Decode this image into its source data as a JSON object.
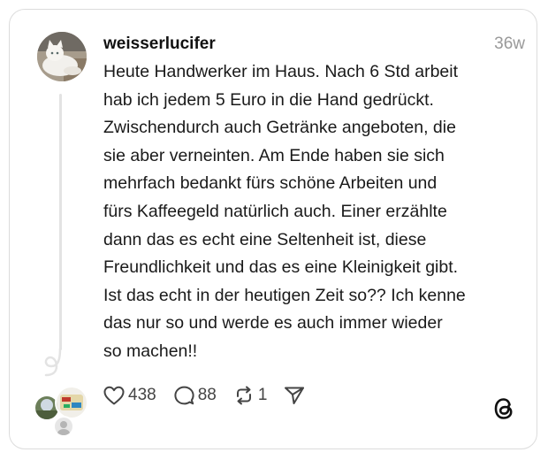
{
  "post": {
    "username": "weisserlucifer",
    "timestamp": "36w",
    "text_lines": [
      "Heute Handwerker im Haus. Nach 6 Std arbeit",
      "hab ich jedem 5 Euro in die Hand gedrückt.",
      "Zwischendurch auch Getränke angeboten, die",
      "sie aber verneinten. Am Ende haben sie sich",
      "mehrfach bedankt fürs schöne Arbeiten und",
      "fürs Kaffeegeld natürlich auch. Einer erzählte",
      "dann das es echt eine Seltenheit ist, diese",
      "Freundlichkeit und das es eine Kleinigkeit gibt.",
      "Ist das echt in der heutigen Zeit so?? Ich kenne",
      "das nur so und werde es auch immer wieder",
      "so machen!!"
    ]
  },
  "actions": {
    "likes": "438",
    "replies": "88",
    "reposts": "1"
  },
  "icons": {
    "like": "heart-icon",
    "reply": "speech-bubble-icon",
    "repost": "repost-arrows-icon",
    "share": "send-icon",
    "brand": "threads-logo-icon"
  },
  "colors": {
    "text": "#111111",
    "muted": "#999999",
    "icon": "#444444",
    "border": "#dcdcdc",
    "thread_line": "#e3e3e3"
  }
}
